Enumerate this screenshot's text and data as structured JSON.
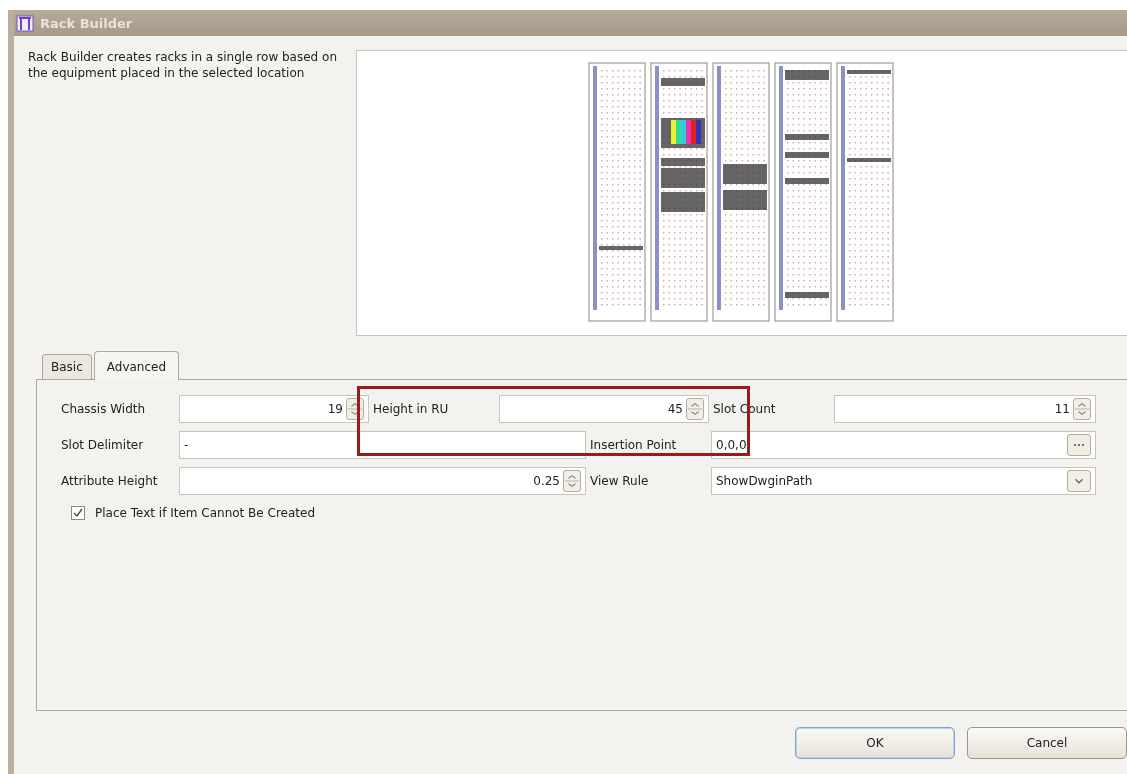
{
  "window": {
    "title": "Rack Builder"
  },
  "description": "Rack Builder  creates racks in a single row based on the equipment placed in the selected location",
  "tabs": [
    {
      "label": "Basic",
      "selected": false
    },
    {
      "label": "Advanced",
      "selected": true
    }
  ],
  "rows": [
    {
      "fields": [
        {
          "label": "Chassis Width",
          "kind": "spin",
          "value": "19"
        },
        {
          "label": "Height in RU",
          "kind": "spin",
          "value": "45"
        },
        {
          "label": "Slot Count",
          "kind": "spin",
          "value": "11"
        }
      ]
    },
    {
      "fields": [
        {
          "label": "Slot Delimiter",
          "kind": "text",
          "value": "-"
        },
        {
          "label": "Insertion Point",
          "kind": "browse",
          "value": "0,0,0"
        }
      ]
    },
    {
      "fields": [
        {
          "label": "Attribute Height",
          "kind": "spin",
          "value": "0.25"
        },
        {
          "label": "View Rule",
          "kind": "dropdown",
          "value": "ShowDwginPath"
        }
      ]
    }
  ],
  "checkbox": {
    "label": "Place Text if Item Cannot Be Created",
    "checked": true
  },
  "buttons": [
    {
      "label": "OK",
      "kind": "default"
    },
    {
      "label": "Cancel",
      "kind": "normal"
    }
  ]
}
